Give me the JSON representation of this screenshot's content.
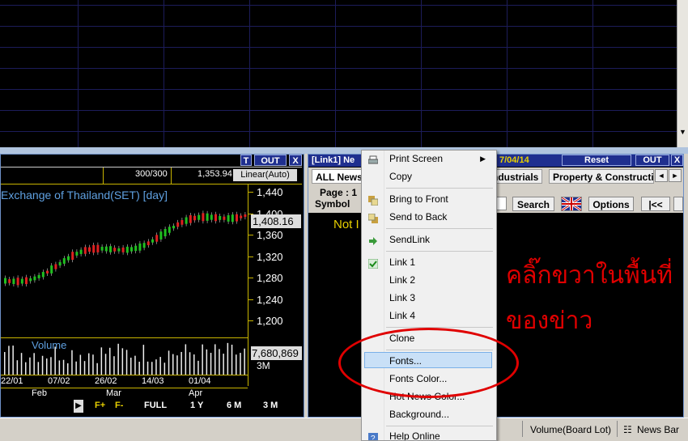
{
  "chart": {
    "t_label": "T",
    "out_label": "OUT",
    "close_label": "X",
    "count": "300/300",
    "index_value": "1,353.94",
    "scale_mode": "Linear(Auto)",
    "title": "Exchange of Thailand(SET) [day]",
    "y_ticks": [
      "1,440",
      "1,400",
      "1,360",
      "1,320",
      "1,280",
      "1,240",
      "1,200"
    ],
    "last_price": "1,408.16",
    "volume_label": "Volume",
    "volume_value": "7,680,869",
    "volume_tick": "3M",
    "dates": [
      "22/01",
      "07/02",
      "26/02",
      "14/03",
      "01/04"
    ],
    "months": [
      "Feb",
      "Mar",
      "Apr"
    ],
    "period_buttons": [
      "F+",
      "F-",
      "FULL",
      "1 Y",
      "6 M",
      "3 M"
    ]
  },
  "news": {
    "title": "[Link1] Ne",
    "date_fragment": "7/04/14",
    "reset_label": "Reset",
    "out_label": "OUT",
    "close_label": "X",
    "tabs": [
      "ALL News",
      "ndustrials",
      "Property & Constructi"
    ],
    "page_label": "Page : 1",
    "symbol_label": "Symbol",
    "search_label": "Search",
    "options_label": "Options",
    "first_label": "|<<",
    "not_found": "Not I",
    "thai_line_1": "คลิ๊กขวาในพื้นที่",
    "thai_line_2": "ของข่าว"
  },
  "status_bar": {
    "volume_board_lot": "Volume(Board Lot)",
    "news_bar": "News Bar"
  },
  "context_menu": {
    "items": [
      {
        "label": "Print Screen",
        "icon": "printer-icon"
      },
      {
        "label": "Copy",
        "icon": ""
      },
      {
        "label": "Bring to Front",
        "icon": "bring-front-icon"
      },
      {
        "label": "Send to Back",
        "icon": "send-back-icon"
      },
      {
        "label": "SendLink",
        "icon": "arrow-right-icon"
      },
      {
        "label": "Link 1",
        "icon": "check-icon"
      },
      {
        "label": "Link 2",
        "icon": ""
      },
      {
        "label": "Link 3",
        "icon": ""
      },
      {
        "label": "Link 4",
        "icon": ""
      },
      {
        "label": "Clone",
        "icon": ""
      },
      {
        "label": "Fonts...",
        "icon": ""
      },
      {
        "label": "Fonts Color...",
        "icon": ""
      },
      {
        "label": "Hot News Color...",
        "icon": ""
      },
      {
        "label": "Background...",
        "icon": ""
      },
      {
        "label": "Help Online",
        "icon": "help-icon"
      }
    ],
    "highlighted": "Fonts..."
  },
  "colors": {
    "up_candle": "#20c020",
    "down_candle": "#e02020",
    "annotation_red": "#e00000",
    "menu_highlight": "#c9e0f7"
  }
}
